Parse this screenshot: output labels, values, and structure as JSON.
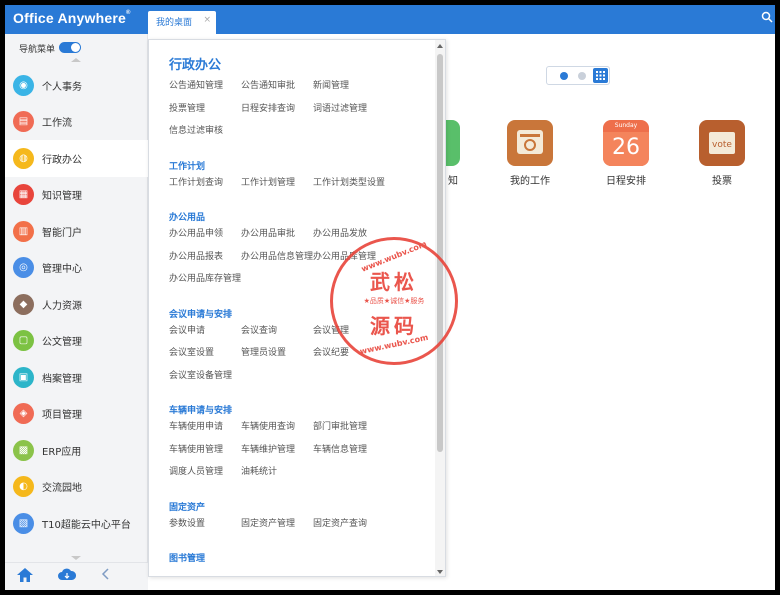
{
  "app": {
    "logo": "Office Anywhere",
    "logo_mark": "®"
  },
  "tabs": [
    {
      "label": "我的桌面",
      "close": "×"
    }
  ],
  "sidebar": {
    "nav_toggle_label": "导航菜单",
    "nav_toggle_on": true,
    "items": [
      {
        "label": "个人事务",
        "color": "#3ab4e6",
        "active": false
      },
      {
        "label": "工作流",
        "color": "#f06b55",
        "active": false
      },
      {
        "label": "行政办公",
        "color": "#f5b81c",
        "active": true
      },
      {
        "label": "知识管理",
        "color": "#e8453c",
        "active": false
      },
      {
        "label": "智能门户",
        "color": "#f27049",
        "active": false
      },
      {
        "label": "管理中心",
        "color": "#4a8ee6",
        "active": false
      },
      {
        "label": "人力资源",
        "color": "#8c6e5e",
        "active": false
      },
      {
        "label": "公文管理",
        "color": "#7cc243",
        "active": false
      },
      {
        "label": "档案管理",
        "color": "#2cb5c9",
        "active": false
      },
      {
        "label": "项目管理",
        "color": "#f06b55",
        "active": false
      },
      {
        "label": "ERP应用",
        "color": "#8bc34a",
        "active": false
      },
      {
        "label": "交流园地",
        "color": "#f5b81c",
        "active": false
      },
      {
        "label": "T10超能云中心平台",
        "color": "#4a8ee6",
        "active": false
      }
    ]
  },
  "panel": {
    "title": "行政办公",
    "sections": [
      {
        "title": "",
        "links": [
          "公告通知管理",
          "公告通知审批",
          "新闻管理",
          "投票管理",
          "日程安排查询",
          "词语过滤管理",
          "信息过滤审核"
        ]
      },
      {
        "title": "工作计划",
        "links": [
          "工作计划查询",
          "工作计划管理",
          "工作计划类型设置"
        ]
      },
      {
        "title": "办公用品",
        "links": [
          "办公用品申领",
          "办公用品审批",
          "办公用品发放",
          "办公用品报表",
          "办公用品信息管理",
          "办公用品库管理",
          "办公用品库存管理"
        ]
      },
      {
        "title": "会议申请与安排",
        "links": [
          "会议申请",
          "会议查询",
          "会议管理",
          "会议室设置",
          "管理员设置",
          "会议纪要",
          "会议室设备管理"
        ]
      },
      {
        "title": "车辆申请与安排",
        "links": [
          "车辆使用申请",
          "车辆使用查询",
          "部门审批管理",
          "车辆使用管理",
          "车辆维护管理",
          "车辆信息管理",
          "调度人员管理",
          "油耗统计"
        ]
      },
      {
        "title": "固定资产",
        "links": [
          "参数设置",
          "固定资产管理",
          "固定资产查询"
        ]
      },
      {
        "title": "图书管理",
        "links": []
      }
    ]
  },
  "desktop": {
    "apps": [
      {
        "label": "我的工作",
        "color": "#c9763a"
      },
      {
        "label": "日程安排",
        "color": "#ee6f4b",
        "date_head": "Sunday",
        "date_num": "26"
      },
      {
        "label": "投票",
        "color": "#b85f2e",
        "badge": "vote"
      }
    ],
    "partial_label": "知"
  },
  "watermark": {
    "url_top": "www.wubv.com",
    "line1": "武松",
    "motto": "★品质★诚信★服务",
    "line2": "源码",
    "url_bottom": "www.wubv.com"
  }
}
